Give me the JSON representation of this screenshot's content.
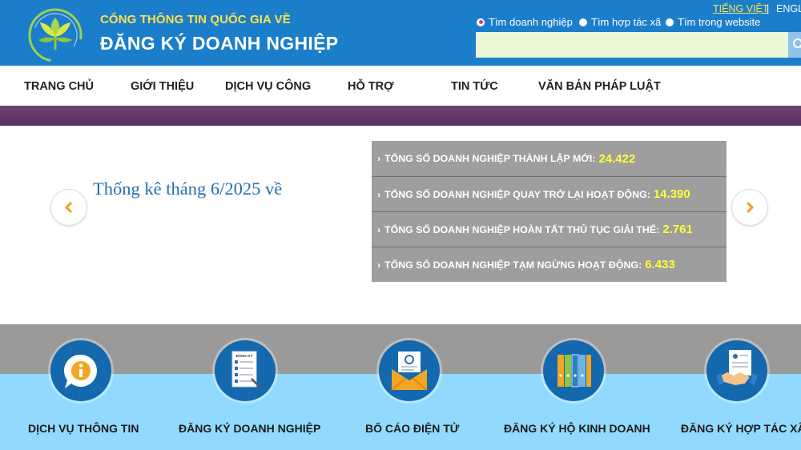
{
  "header": {
    "portal_subtitle": "CỔNG THÔNG TIN QUỐC GIA VỀ",
    "portal_title": "ĐĂNG KÝ DOANH NGHIỆP",
    "lang_vi": "TIẾNG VIỆT",
    "lang_sep": "|",
    "lang_en": "ENGL",
    "search_options": [
      "Tìm doanh nghiệp",
      "Tìm hợp tác xã",
      "Tìm trong website"
    ],
    "selected_search_option": "Tìm doanh nghiệp",
    "search_value": "",
    "search_icon": "search-icon"
  },
  "nav": {
    "items": [
      "TRANG CHỦ",
      "GIỚI THIỆU",
      "DỊCH VỤ CÔNG",
      "HỖ TRỢ",
      "TIN TỨC",
      "VĂN BẢN PHÁP LUẬT"
    ]
  },
  "slider": {
    "caption": "Thống kê tháng 6/2025 về",
    "prev_icon": "chevron-left-icon",
    "next_icon": "chevron-right-icon",
    "stats": [
      {
        "label": "TỔNG SỐ DOANH NGHIỆP THÀNH LẬP MỚI:",
        "value": "24.422"
      },
      {
        "label": "TỔNG SỐ DOANH NGHIỆP QUAY TRỞ LẠI HOẠT ĐỘNG:",
        "value": "14.390"
      },
      {
        "label": "TỔNG SỐ DOANH NGHIỆP HOÀN TẤT THỦ TỤC GIẢI THỂ:",
        "value": "2.761"
      },
      {
        "label": "TỔNG SỐ DOANH NGHIỆP TẠM NGỪNG HOẠT ĐỘNG:",
        "value": "6.433"
      }
    ]
  },
  "services": [
    {
      "label": "DỊCH VỤ THÔNG TIN",
      "icon": "info-bubble-icon"
    },
    {
      "label": "ĐĂNG KÝ DOANH NGHIỆP",
      "icon": "document-checklist-icon",
      "icon_text": "ĐĂNG KÝ"
    },
    {
      "label": "BỐ CÁO ĐIỆN TỬ",
      "icon": "email-envelope-icon"
    },
    {
      "label": "ĐĂNG KÝ HỘ KINH DOANH",
      "icon": "binders-icon"
    },
    {
      "label": "ĐĂNG KÝ HỢP TÁC XÃ",
      "icon": "handshake-icon"
    }
  ],
  "colors": {
    "header_bg": "#1a7ecb",
    "accent_yellow": "#ffe14d",
    "stat_value": "#ffff33",
    "band": "#5a2f61",
    "service_bg": "#92dafd",
    "icon_bg": "#1468ae"
  }
}
